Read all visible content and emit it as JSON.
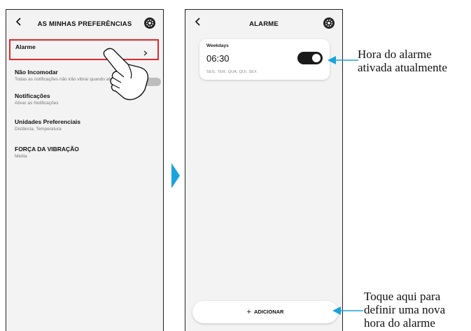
{
  "left_screen": {
    "title": "AS MINHAS PREFERÊNCIAS",
    "items": [
      {
        "label": "Alarme",
        "sub": ""
      },
      {
        "label": "Não Incomodar",
        "sub": "Todas as notificações não irão vibrar quando ativadas."
      },
      {
        "label": "Notificações",
        "sub": "Ativar as Notificações"
      },
      {
        "label": "Unidades Preferenciais",
        "sub": "Distância, Temperatura"
      },
      {
        "label": "FORÇA DA VIBRAÇÃO",
        "sub": "Média"
      }
    ]
  },
  "right_screen": {
    "title": "ALARME",
    "alarm": {
      "name": "Weekdays",
      "time": "06:30",
      "days": "SEG, TER, QUA, QUI, SEX",
      "enabled": true
    },
    "add_label": "ADICIONAR"
  },
  "callouts": {
    "alarm_active": "Hora do alarme\nativada atualmente",
    "add_new": "Toque aqui para\ndefinir uma nova\nhora do alarme"
  },
  "colors": {
    "highlight": "#e22a2a",
    "callout_line": "#1aa3dd",
    "transition_arrow": "#1aa3dd"
  }
}
